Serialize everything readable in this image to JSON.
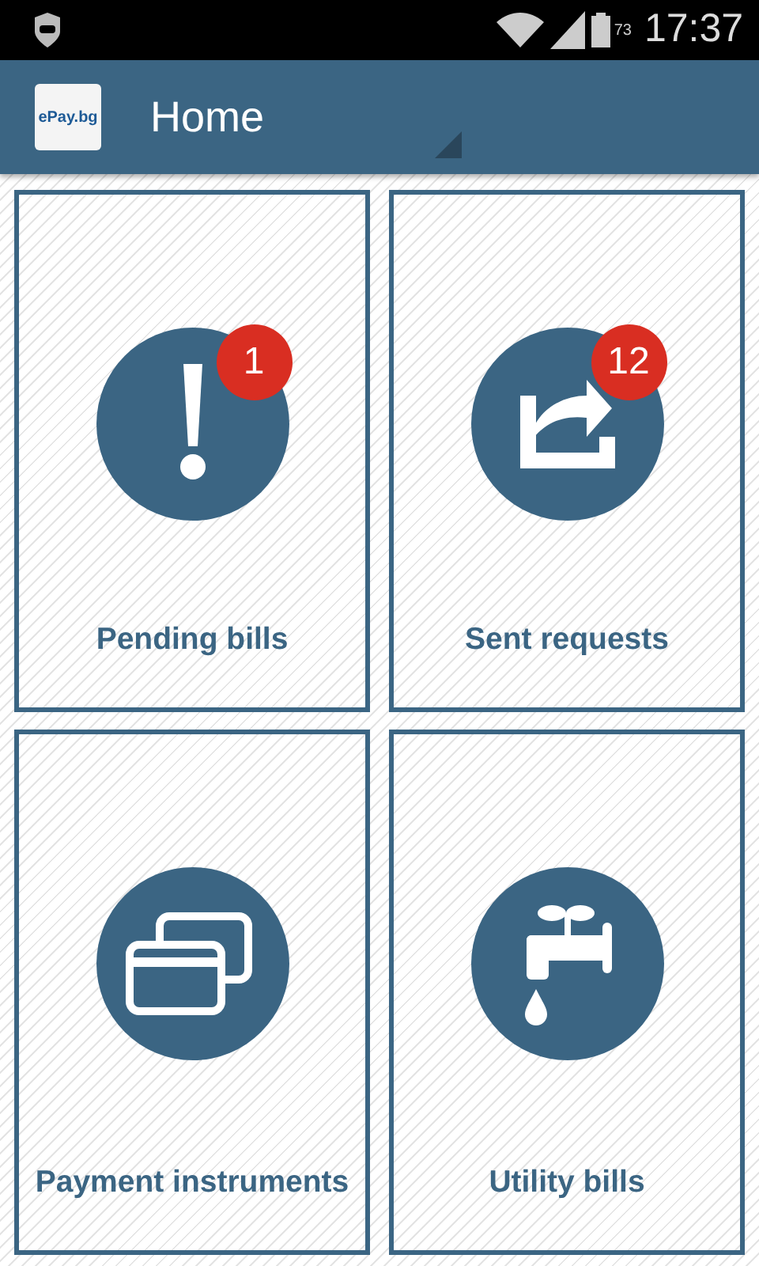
{
  "status_bar": {
    "time": "17:37",
    "battery": "73"
  },
  "app_bar": {
    "logo": "ePay.bg",
    "title": "Home"
  },
  "tiles": [
    {
      "label": "Pending bills",
      "badge": "1"
    },
    {
      "label": "Sent requests",
      "badge": "12"
    },
    {
      "label": "Payment instruments"
    },
    {
      "label": "Utility bills"
    }
  ]
}
